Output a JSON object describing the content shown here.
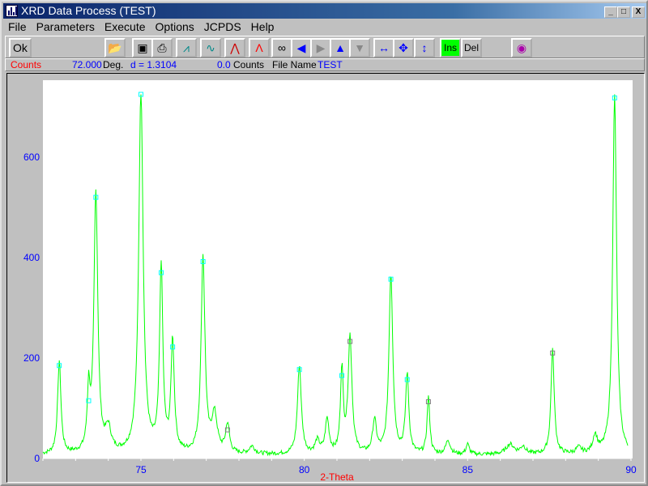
{
  "window": {
    "title": "XRD Data Process (TEST)",
    "min": "_",
    "max": "□",
    "close": "X"
  },
  "menu": [
    "File",
    "Parameters",
    "Execute",
    "Options",
    "JCPDS",
    "Help"
  ],
  "toolbar": {
    "ok": "Ok",
    "ins": "Ins",
    "del": "Del",
    "icons": [
      "open-folder-icon",
      "save-disk-icon",
      "print-icon",
      "peaks-icon",
      "smooth-icon",
      "background-icon",
      "peak-fit-icon",
      "binoculars-icon",
      "arrow-left-icon",
      "arrow-right-icon",
      "arrow-up-icon",
      "arrow-down-icon",
      "expand-horizontal-icon",
      "expand-all-icon",
      "expand-vertical-icon",
      "cd-icon"
    ]
  },
  "status": {
    "label": "Counts",
    "deg_value": "72.000",
    "deg_unit": "Deg.",
    "d": "d = 1.3104",
    "counts_value": "0.0",
    "counts_unit": "Counts",
    "file_label": "File Name :",
    "file_name": "TEST"
  },
  "chart_data": {
    "type": "line",
    "xlabel": "2-Theta",
    "ylabel": "",
    "xlim": [
      72,
      90
    ],
    "ylim": [
      0,
      725
    ],
    "xticks": [
      75,
      80,
      85,
      90
    ],
    "yticks": [
      0,
      200,
      400,
      600
    ],
    "line_color": "#00ff00",
    "marker_color": "#00ffff",
    "marker_alt_color": "#808080",
    "peaks": [
      {
        "x": 72.5,
        "y": 185,
        "w": 0.06,
        "m": "c"
      },
      {
        "x": 73.4,
        "y": 115,
        "w": 0.05,
        "m": "c"
      },
      {
        "x": 73.62,
        "y": 520,
        "w": 0.07,
        "m": "c"
      },
      {
        "x": 74.0,
        "y": 45,
        "w": 0.1
      },
      {
        "x": 75.0,
        "y": 725,
        "w": 0.08,
        "m": "c"
      },
      {
        "x": 75.62,
        "y": 370,
        "w": 0.06,
        "m": "c"
      },
      {
        "x": 75.97,
        "y": 222,
        "w": 0.06,
        "m": "c"
      },
      {
        "x": 76.9,
        "y": 392,
        "w": 0.07,
        "m": "c"
      },
      {
        "x": 77.25,
        "y": 75,
        "w": 0.1
      },
      {
        "x": 77.65,
        "y": 57,
        "w": 0.07,
        "m": "g"
      },
      {
        "x": 78.4,
        "y": 15,
        "w": 0.1
      },
      {
        "x": 79.85,
        "y": 177,
        "w": 0.07,
        "m": "c"
      },
      {
        "x": 80.4,
        "y": 25,
        "w": 0.08
      },
      {
        "x": 80.7,
        "y": 68,
        "w": 0.07
      },
      {
        "x": 81.15,
        "y": 165,
        "w": 0.05,
        "m": "c"
      },
      {
        "x": 81.4,
        "y": 233,
        "w": 0.07,
        "m": "g"
      },
      {
        "x": 82.15,
        "y": 65,
        "w": 0.07
      },
      {
        "x": 82.65,
        "y": 357,
        "w": 0.07,
        "m": "c"
      },
      {
        "x": 83.15,
        "y": 157,
        "w": 0.06,
        "m": "c"
      },
      {
        "x": 83.8,
        "y": 113,
        "w": 0.05,
        "m": "g"
      },
      {
        "x": 84.4,
        "y": 28,
        "w": 0.08
      },
      {
        "x": 85.0,
        "y": 20,
        "w": 0.06
      },
      {
        "x": 86.3,
        "y": 20,
        "w": 0.15
      },
      {
        "x": 86.7,
        "y": 15,
        "w": 0.1
      },
      {
        "x": 87.6,
        "y": 210,
        "w": 0.06,
        "m": "g"
      },
      {
        "x": 88.4,
        "y": 12,
        "w": 0.1
      },
      {
        "x": 88.9,
        "y": 35,
        "w": 0.08
      },
      {
        "x": 89.5,
        "y": 718,
        "w": 0.07,
        "m": "c"
      }
    ]
  }
}
